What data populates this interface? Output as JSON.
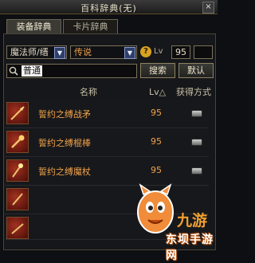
{
  "window": {
    "title": "百科辞典(无)",
    "close_label": "×"
  },
  "tabs": [
    {
      "label": "装备辞典",
      "active": true
    },
    {
      "label": "卡片辞典",
      "active": false
    }
  ],
  "filters": {
    "class_select": "魔法师/缙",
    "rarity_select": "传说",
    "lv_label": "Lv",
    "lv_value": "95",
    "lv_value2": ""
  },
  "search": {
    "value": "普通",
    "search_button": "搜索",
    "default_button": "默认"
  },
  "table": {
    "headers": {
      "name": "名称",
      "lv": "Lv△",
      "source": "获得方式"
    },
    "rows": [
      {
        "name": "誓约之缚战矛",
        "lv": "95"
      },
      {
        "name": "誓约之缚棍棒",
        "lv": "95"
      },
      {
        "name": "誓约之缚魔杖",
        "lv": "95"
      },
      {
        "name": "",
        "lv": ""
      },
      {
        "name": "",
        "lv": ""
      }
    ]
  },
  "watermark": {
    "text": "东坝手游网",
    "logo": "九游"
  },
  "colors": {
    "accent_orange": "#f1a24a",
    "border": "#7a7159",
    "background": "#0e0f12"
  }
}
